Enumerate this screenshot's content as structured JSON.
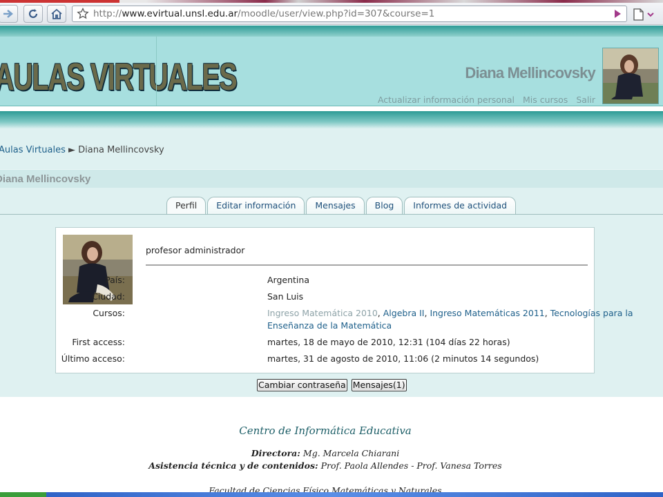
{
  "browser": {
    "url_prefix": "http://",
    "url_host": "www.evirtual.unsl.edu.ar",
    "url_path": "/moodle/user/view.php?id=307&course=1"
  },
  "header": {
    "logo_text": "AULAS VIRTUALES",
    "user_name": "Diana Mellincovsky",
    "links": [
      "Actualizar información personal",
      "Mis cursos",
      "Salir"
    ]
  },
  "breadcrumb": {
    "home": "Aulas Virtuales",
    "separator": "►",
    "current": "Diana Mellincovsky"
  },
  "page_title": "Diana Mellincovsky",
  "tabs": [
    "Perfil",
    "Editar información",
    "Mensajes",
    "Blog",
    "Informes de actividad"
  ],
  "profile": {
    "role": "profesor administrador",
    "pais_label": "País:",
    "pais": "Argentina",
    "ciudad_label": "Ciudad:",
    "ciudad": "San Luis",
    "cursos_label": "Cursos:",
    "cursos": [
      "Ingreso Matemática 2010",
      "Algebra II",
      "Ingreso Matemáticas 2011",
      "Tecnologías para la",
      "Enseñanza de la Matemática"
    ],
    "first_access_label": "First access:",
    "first_access": "martes, 18 de mayo de 2010, 12:31  (104 días 22 horas)",
    "last_access_label": "Último acceso:",
    "last_access": "martes, 31 de agosto de 2010, 11:06  (2 minutos 14 segundos)"
  },
  "buttons": {
    "change_password": "Cambiar contraseña",
    "messages": "Mensajes(1)"
  },
  "footer": {
    "title": "Centro de Informática Educativa",
    "director_label": "Directora:",
    "director": "Mg. Marcela Chiarani",
    "support_label": "Asistencia técnica y de contenidos:",
    "support": "Prof. Paola Allendes - Prof. Vanesa Torres",
    "faculty": "Facultad de Ciencias Físico Matemáticas y Naturales"
  },
  "colors": {
    "header_band": "#a7dfdf",
    "teal_stripe": "#2d9b96",
    "content_bg": "#dff1f1",
    "link": "#1d5f8a"
  }
}
